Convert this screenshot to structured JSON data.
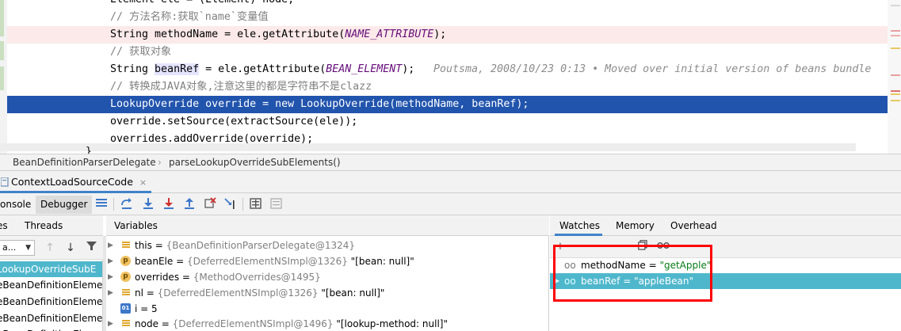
{
  "colors": {
    "accent": "#4083c9",
    "selection_line": "#2154ad",
    "selected_row": "#4fb7cc",
    "annotation_box": "#ff0000",
    "comment": "#808080",
    "constant": "#660e7a"
  },
  "editor": {
    "lines": [
      {
        "text": "Element ele = (Element) node;"
      },
      {
        "text": "// 方法名称:获取`name`变量值"
      },
      {
        "pre": "String methodName = ele.getAttribute(",
        "const": "NAME_ATTRIBUTE",
        "post": ");"
      },
      {
        "text": "// 获取对象"
      },
      {
        "pre": "String ",
        "ident": "beanRef",
        "mid": " = ele.getAttribute(",
        "const": "BEAN_ELEMENT",
        "post": ");"
      },
      {
        "text": "// 转换成JAVA对象,注意这里的都是字符串不是clazz"
      },
      {
        "text": "LookupOverride override = new LookupOverride(methodName, beanRef);"
      },
      {
        "text": "override.setSource(extractSource(ele));"
      },
      {
        "text": "overrides.addOverride(override);"
      },
      {
        "text": "}"
      }
    ],
    "blame": "Poutsma, 2008/10/23 0:13 • Moved over initial version of beans bundle"
  },
  "breadcrumb": {
    "class_name": "BeanDefinitionParserDelegate",
    "separator": "›",
    "method_name": "parseLookupOverrideSubElements()"
  },
  "run_tab": {
    "label": "ContextLoadSourceCode",
    "close": "×",
    "icon": "run-config-icon"
  },
  "toolbar": {
    "console_label": "onsole",
    "debugger_label": "Debugger",
    "icons": [
      "layout-icon",
      "show-execution-point-icon",
      "step-over-icon",
      "step-into-icon",
      "force-step-into-icon",
      "step-out-icon",
      "drop-frame-icon",
      "run-to-cursor-icon",
      "evaluate-expression-icon",
      "trace-icon"
    ]
  },
  "frames_panel": {
    "tab_frames": "es",
    "tab_threads": "Threads",
    "thread_select": "a...",
    "frames": [
      "LookupOverrideSubE",
      "eBeanDefinitionElemen",
      "eBeanDefinitionElemen",
      "eBeanDefinitionElemen",
      "eBeanDefinitionElemen"
    ]
  },
  "variables_panel": {
    "title": "Variables",
    "rows": [
      {
        "icon": "field-icon",
        "name": "this",
        "eq": " = ",
        "type": "{BeanDefinitionParserDelegate@1324}",
        "str": ""
      },
      {
        "icon": "param-icon",
        "glyph": "p",
        "name": "beanEle",
        "eq": " = ",
        "type": "{DeferredElementNSImpl@1326}",
        "str": " \"[bean: null]\""
      },
      {
        "icon": "param-icon",
        "glyph": "p",
        "name": "overrides",
        "eq": " = ",
        "type": "{MethodOverrides@1495}",
        "str": ""
      },
      {
        "icon": "field-icon",
        "name": "nl",
        "eq": " = ",
        "type": "{DeferredElementNSImpl@1326}",
        "str": " \"[bean: null]\""
      },
      {
        "icon": "primitive-icon",
        "glyph": "01",
        "name": "i",
        "eq": " = ",
        "type": "",
        "str": "5"
      },
      {
        "icon": "field-icon",
        "name": "node",
        "eq": " = ",
        "type": "{DeferredElementNSImpl@1496}",
        "str": " \"[lookup-method: null]\""
      }
    ]
  },
  "watches_panel": {
    "tabs": [
      "Watches",
      "Memory",
      "Overhead"
    ],
    "tool_icons": [
      "add-icon",
      "remove-icon",
      "move-up-icon",
      "copy-icon",
      "glasses-icon"
    ],
    "rows": [
      {
        "name": "methodName",
        "eq": " = ",
        "value": "\"getApple\""
      },
      {
        "name": "beanRef",
        "eq": " = ",
        "value": "\"appleBean\""
      }
    ]
  }
}
